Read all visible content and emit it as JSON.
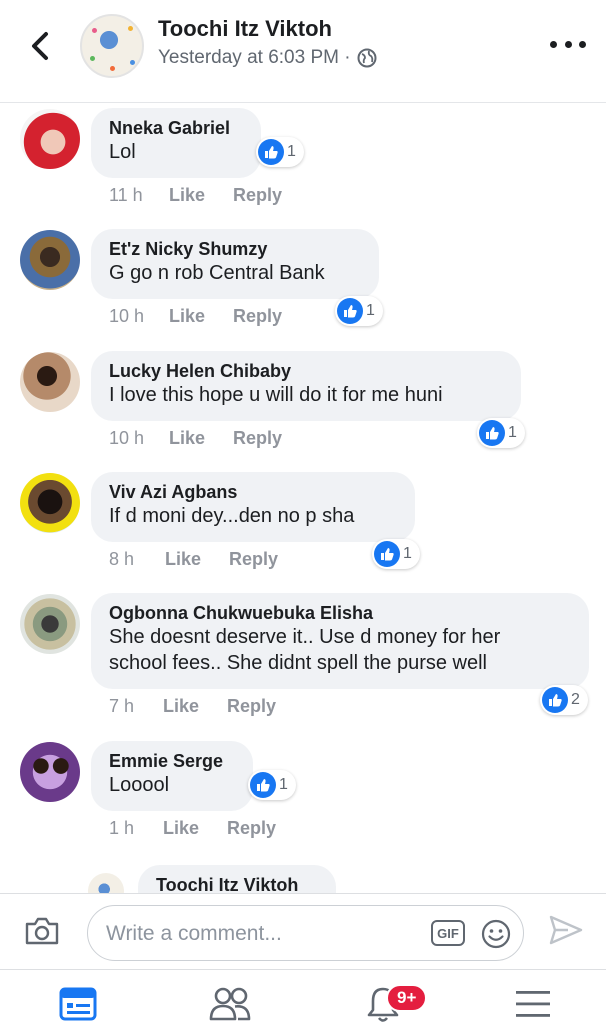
{
  "header": {
    "title": "Toochi Itz Viktoh",
    "subtitle": "Yesterday at 6:03 PM ·",
    "privacy_icon": "globe-icon"
  },
  "comments": [
    {
      "name": "Nneka Gabriel",
      "text": "Lol",
      "time": "11 h",
      "like": "Like",
      "reply": "Reply",
      "reactions": "1"
    },
    {
      "name": "Et'z Nicky Shumzy",
      "text": "G go n rob Central Bank",
      "time": "10 h",
      "like": "Like",
      "reply": "Reply",
      "reactions": "1"
    },
    {
      "name": "Lucky Helen Chibaby",
      "text": "I love this hope u will do it for me huni",
      "time": "10 h",
      "like": "Like",
      "reply": "Reply",
      "reactions": "1"
    },
    {
      "name": "Viv Azi Agbans",
      "text": "If d moni dey...den no p sha",
      "time": "8 h",
      "like": "Like",
      "reply": "Reply",
      "reactions": "1"
    },
    {
      "name": "Ogbonna Chukwuebuka Elisha",
      "text": "She doesnt deserve it.. Use d money for her",
      "text2": "school fees.. She didnt spell the purse well",
      "time": "7 h",
      "like": "Like",
      "reply": "Reply",
      "reactions": "2"
    },
    {
      "name": "Emmie Serge",
      "text": "Looool",
      "time": "1 h",
      "like": "Like",
      "reply": "Reply",
      "reactions": "1"
    },
    {
      "name": "Toochi Itz Viktoh"
    }
  ],
  "composer": {
    "placeholder": "Write a comment...",
    "gif_label": "GIF"
  },
  "nav": {
    "notifications_badge": "9+"
  },
  "colors": {
    "accent": "#1877f2",
    "badge": "#e41e3f",
    "bubble": "#f0f2f5",
    "meta": "#90949c"
  }
}
